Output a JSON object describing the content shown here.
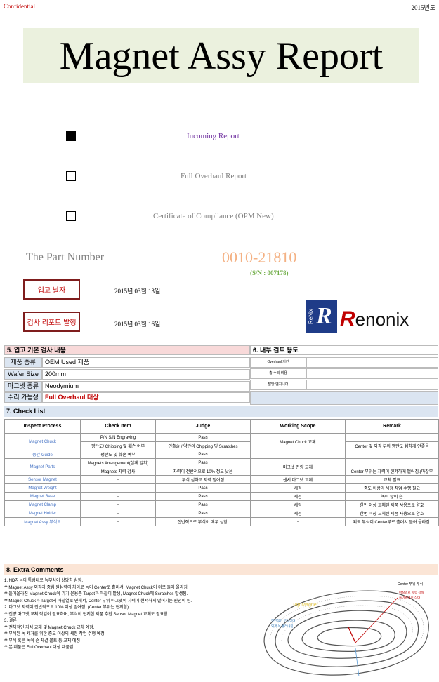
{
  "header": {
    "confidential": "Confidential",
    "year": "2015년도"
  },
  "title": "Magnet Assy Report",
  "checkboxes": [
    {
      "label": "Incoming Report",
      "checked": true,
      "color": "#7030a0"
    },
    {
      "label": "Full Overhaul Report",
      "checked": false,
      "color": "#808080"
    },
    {
      "label": "Certificate of Compliance (OPM New)",
      "checked": false,
      "color": "#808080"
    }
  ],
  "part": {
    "label": "The Part Number",
    "number": "0010-21810",
    "serial": "(S/N : 007178)"
  },
  "dates": [
    {
      "label": "입고 날자",
      "value": "2015년 03월 13일"
    },
    {
      "label": "검사 리포트 발행",
      "value": "2015년 03월 16일"
    }
  ],
  "logo": {
    "vertical": "ReNix",
    "mark": "R",
    "first_letter": "R",
    "rest": "enonix"
  },
  "section5": {
    "title": "5. 입고 기본 검사 내용",
    "rows": [
      {
        "key": "제품 종류",
        "value": "OEM Used 제품",
        "color": "#000000"
      },
      {
        "key": "Wafer Size",
        "value": "200mm",
        "color": "#000000"
      },
      {
        "key": "마그넷 종류",
        "value": "Neodymium",
        "color": "#000000"
      },
      {
        "key": "수리 가능성",
        "value": "Full Overhaul 대상",
        "color": "#c00000"
      }
    ]
  },
  "section6": {
    "title": "6. 내부 검토 용도",
    "rows": [
      "Overhaul 기간",
      "총 수리 비용",
      "담당 엔지니어"
    ]
  },
  "section7": {
    "title": "7. Check List",
    "headers": [
      "Inspect Process",
      "Check Item",
      "Judge",
      "Working Scope",
      "Remark"
    ],
    "rows": [
      [
        "Magnet Chuck",
        "P/N S/N Engraving",
        "Pass",
        "Magnet Chuck 교체",
        ""
      ],
      [
        "",
        "평탄도/ Chipping 및 훼손 여부",
        "인출솔 / 약간의 Chipping 및 Scratches",
        "",
        "Center 및 외곽 부위 평탄도 심하게 안좋음"
      ],
      [
        "중간 Guide",
        "평탄도 및 훼손 여부",
        "Pass",
        "",
        ""
      ],
      [
        "Magnet Parts",
        "Magnets Arrangement(설계 일치)",
        "Pass",
        "마그넷 전량 교체",
        ""
      ],
      [
        "",
        "Magnets 자력 검사",
        "자력이 전반적으로 10% 정도 낮음",
        "",
        "Center 부위는 자력이 현저하게 떨어짐.(마찰부"
      ],
      [
        "Sensor Magnet",
        "-",
        "부식 심하고 자력 떨어짐",
        "센서 마그넷 교체",
        "교체 필요"
      ],
      [
        "Magnet Weight",
        "-",
        "Pass",
        "세정",
        "중도 이상의 세정 작업 수행 필요"
      ],
      [
        "Magnet Base",
        "-",
        "Pass",
        "세정",
        "녹이 많이 슴"
      ],
      [
        "Magnet Clamp",
        "-",
        "Pass",
        "세정",
        "한번 이상 교체된 제품 사용으로 양호"
      ],
      [
        "Magnet Holder",
        "-",
        "Pass",
        "세정",
        "한번 이상 교체된 제품 사용으로 양호"
      ],
      [
        "Magnet Assy 부식도",
        "-",
        "전반적으로 부식이 매우 심함.",
        "-",
        "외곽 부식이 Center부로 흘러서 들어 올라짐."
      ]
    ]
  },
  "section8": {
    "title": "8. Extra Comments",
    "lines": [
      "1. ND자석의 특성대로 녹부식이 상당히 심함.",
      "  ** Magnet Assy 외곽과 중심 원심력의 차이로 녹이 Center로 흘러서, Magnet Chuck이 위로 들어 올라짐.",
      "  ** 들어올라진 Magnet Chuck이 기기 운용중 Target과 마찰이 발생, Magnet Chuck에 Scratches 발생됨.",
      "  ** Magnet Chuck과 Target의 마찰열로 인해서, Center 부위 마그넷의 자력이 현저하게 떨어지는 원인이 됨.",
      "2. 마그넷 자력이 전반적으로 10% 이상 떨어짐. (Center 부위는 현저함)",
      "  ** 전량 마그넷 교체 작업이 필요하며, 부식이 현저한 제품 추천 Sensor Magnet 교체도 필요함.",
      "3. 결론",
      "  ** 전체적인 자석 교체 및 Magnet Chuck 교체 예정.",
      "  ** 부식된 녹 제거를 위한 중도 이상의 세정 작업 수행 예정.",
      "  ** 부식 혹은 녹이 슨 체결 볼트 등 교체 예정",
      "  ** 본 제품은 Full Overhaul 대상 제품임."
    ]
  },
  "diagram": {
    "callout_center": "Center 부위 부식",
    "callout_lift": "마찰열로 자력 상실",
    "callout_lift2": "들어올려진 상태",
    "label_left": "전반적인 부식상태",
    "label_left2": "외곽 녹 흘러내림",
    "label_top": "Top Magnet"
  }
}
